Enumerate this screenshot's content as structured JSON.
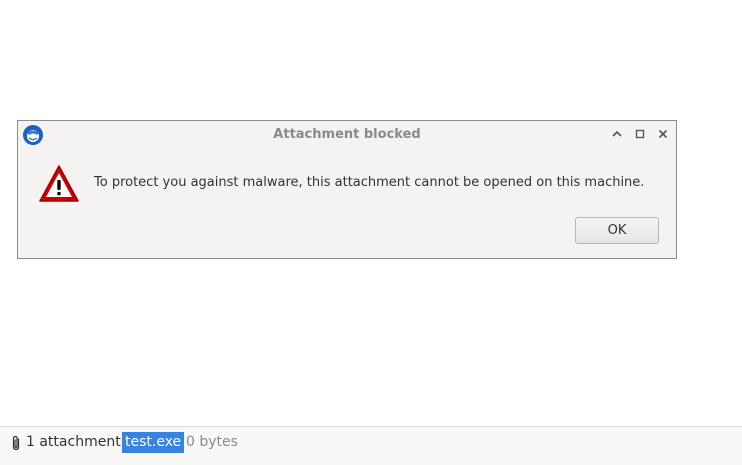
{
  "dialog": {
    "title": "Attachment blocked",
    "message": "To protect you against malware, this attachment cannot be opened on this machine.",
    "ok_label": "OK",
    "icon": "warning-icon",
    "app_icon": "thunderbird-icon"
  },
  "window_controls": {
    "minimize_icon": "chevron-up-icon",
    "maximize_icon": "maximize-icon",
    "close_icon": "close-icon"
  },
  "attachments": {
    "count_label": "1 attachment:",
    "file_name": "test.exe",
    "file_size": "0 bytes",
    "icon": "paperclip-icon"
  },
  "colors": {
    "selection": "#3584e4",
    "warning_red": "#cc0000",
    "dialog_bg": "#f4f3f2"
  }
}
